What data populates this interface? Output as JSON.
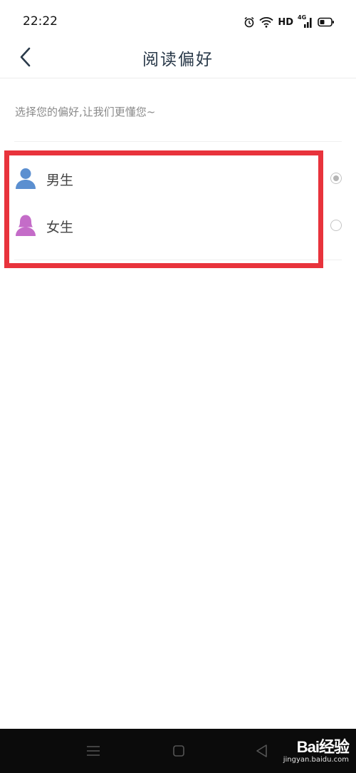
{
  "status_bar": {
    "time": "22:22",
    "hd": "HD",
    "network": "4G"
  },
  "header": {
    "title": "阅读偏好"
  },
  "hint": "选择您的偏好,让我们更懂您~",
  "options": [
    {
      "label": "男生",
      "icon": "male-user-icon",
      "color": "#5b8fd0",
      "selected": true
    },
    {
      "label": "女生",
      "icon": "female-user-icon",
      "color": "#c46cc8",
      "selected": false
    }
  ],
  "highlight_color": "#e8333c",
  "watermark": {
    "brand": "Bai经验",
    "url": "jingyan.baidu.com"
  }
}
